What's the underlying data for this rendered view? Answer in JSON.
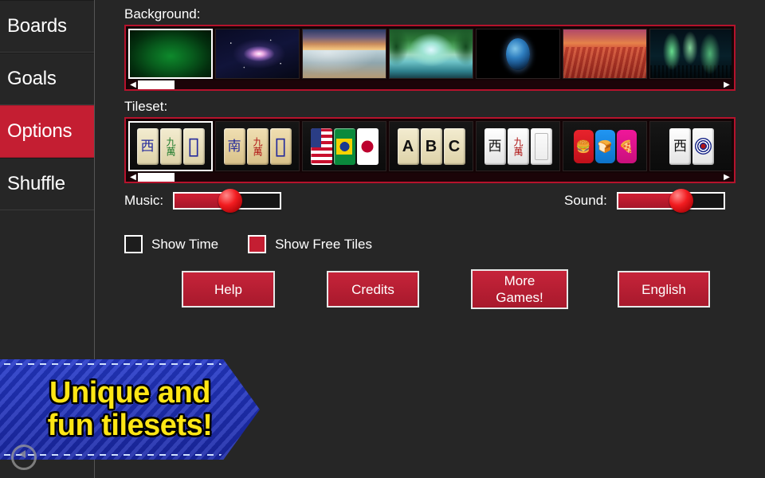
{
  "sidebar": {
    "items": [
      {
        "label": "Boards",
        "active": false
      },
      {
        "label": "Goals",
        "active": false
      },
      {
        "label": "Options",
        "active": true
      },
      {
        "label": "Shuffle",
        "active": false
      }
    ]
  },
  "background_section": {
    "label": "Background:",
    "selected_index": 0,
    "scroll_left_icon": "◀",
    "scroll_right_icon": "▶",
    "thumbs": [
      {
        "name": "green-felt",
        "css": "bg-green"
      },
      {
        "name": "galaxy",
        "css": "bg-galaxy"
      },
      {
        "name": "beach-sunset",
        "css": "bg-beach"
      },
      {
        "name": "jungle-waterfall",
        "css": "bg-jungle"
      },
      {
        "name": "earth-from-space",
        "css": "bg-earth"
      },
      {
        "name": "red-desert",
        "css": "bg-desert"
      },
      {
        "name": "aurora-borealis",
        "css": "bg-aurora"
      }
    ]
  },
  "tileset_section": {
    "label": "Tileset:",
    "selected_index": 0,
    "scroll_left_icon": "◀",
    "scroll_right_icon": "▶",
    "thumbs": [
      {
        "name": "classic-ivory",
        "tiles": [
          {
            "style": "ivory",
            "glyph": "西",
            "color": "ch-b"
          },
          {
            "style": "ivory",
            "glyph": "九萬",
            "color": "ch-g"
          },
          {
            "style": "ivory",
            "glyph": "▯",
            "color": "ch-b"
          }
        ]
      },
      {
        "name": "classic-tan",
        "tiles": [
          {
            "style": "tan",
            "glyph": "南",
            "color": "ch-b"
          },
          {
            "style": "tan",
            "glyph": "九萬",
            "color": "ch-r"
          },
          {
            "style": "tan",
            "glyph": "▯",
            "color": "ch-b"
          }
        ]
      },
      {
        "name": "flags",
        "flags": [
          "fl-us",
          "fl-br",
          "fl-jp"
        ]
      },
      {
        "name": "letters",
        "tiles": [
          {
            "style": "ivory",
            "glyph": "A",
            "color": "ch-k"
          },
          {
            "style": "ivory",
            "glyph": "B",
            "color": "ch-k"
          },
          {
            "style": "ivory",
            "glyph": "C",
            "color": "ch-k"
          }
        ]
      },
      {
        "name": "white-modern",
        "tiles": [
          {
            "style": "white",
            "glyph": "西",
            "color": "ch-k"
          },
          {
            "style": "white",
            "glyph": "九萬",
            "color": "ch-r"
          },
          {
            "style": "white",
            "glyph": "",
            "color": "ch-k"
          }
        ]
      },
      {
        "name": "food-icons",
        "food": [
          {
            "style": "f-red",
            "glyph": "🍔"
          },
          {
            "style": "f-blue",
            "glyph": "🍞"
          },
          {
            "style": "f-pink",
            "glyph": "🍕"
          }
        ]
      },
      {
        "name": "bamboo-circles",
        "tiles": [
          {
            "style": "white",
            "glyph": "西",
            "color": "ch-k"
          },
          {
            "style": "white",
            "glyph": "◉",
            "color": "ch-b"
          }
        ]
      }
    ]
  },
  "music": {
    "label": "Music:",
    "value_percent": 53
  },
  "sound": {
    "label": "Sound:",
    "value_percent": 60
  },
  "checkboxes": [
    {
      "name": "show-time",
      "label": "Show Time",
      "checked": false
    },
    {
      "name": "show-free-tiles",
      "label": "Show Free Tiles",
      "checked": true
    }
  ],
  "buttons": [
    {
      "name": "help",
      "label": "Help"
    },
    {
      "name": "credits",
      "label": "Credits"
    },
    {
      "name": "more-games",
      "label": "More\nGames!"
    },
    {
      "name": "language",
      "label": "English"
    }
  ],
  "banner": {
    "line1": "Unique and",
    "line2": "fun tilesets!"
  },
  "colors": {
    "accent_red": "#c41e32",
    "panel_border": "#b5122c",
    "page_bg": "#262626",
    "banner_blue": "#2438c8",
    "banner_yellow": "#ffe615"
  }
}
